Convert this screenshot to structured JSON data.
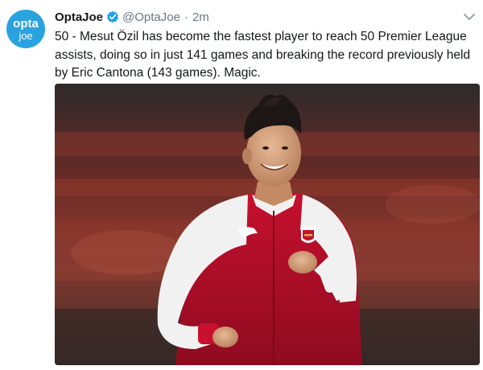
{
  "author": {
    "avatar_line1": "opta",
    "avatar_line2": "joe",
    "name": "OptaJoe",
    "handle": "@OptaJoe",
    "separator": "·",
    "time": "2m",
    "verified_icon": "verified-badge-icon",
    "menu_icon": "chevron-down-icon"
  },
  "tweet": {
    "text": "50 - Mesut Özil has become the fastest player to reach 50 Premier League assists, doing so in just 141 games and breaking the record previously held by Eric Cantona (143 games). Magic."
  },
  "media": {
    "crest_icon": "arsenal-crest-icon",
    "brand_icon": "puma-logo-icon"
  },
  "colors": {
    "brand_blue": "#1da1f2",
    "avatar_blue": "#2aa2e0",
    "kit_red": "#c8102e",
    "text_gray": "#657786"
  }
}
